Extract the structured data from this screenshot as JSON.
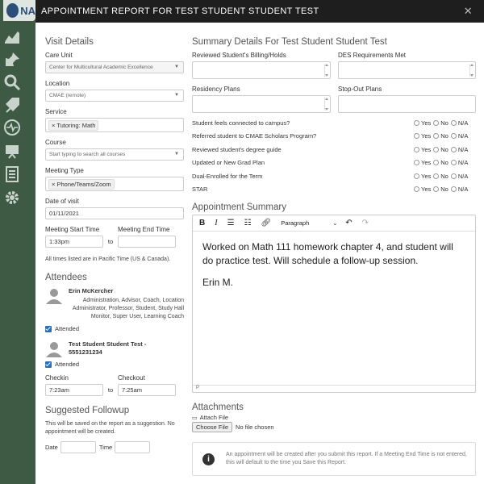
{
  "app": {
    "logo_text": "NA"
  },
  "modal": {
    "title": "APPOINTMENT REPORT FOR TEST STUDENT STUDENT TEST",
    "close": "✕"
  },
  "visit": {
    "title": "Visit Details",
    "care_unit": {
      "label": "Care Unit",
      "value": "Center for Multicultural Academic Excellence"
    },
    "location": {
      "label": "Location",
      "value": "CMAE (remote)"
    },
    "service": {
      "label": "Service",
      "tag": "Tutoring: Math"
    },
    "course": {
      "label": "Course",
      "placeholder": "Start typing to search all courses"
    },
    "meeting_type": {
      "label": "Meeting Type",
      "tag": "Phone/Teams/Zoom"
    },
    "date": {
      "label": "Date of visit",
      "value": "01/11/2021"
    },
    "start": {
      "label": "Meeting Start Time",
      "value": "1:33pm"
    },
    "end": {
      "label": "Meeting End Time",
      "value": ""
    },
    "to": "to",
    "tz_note": "All times listed are in Pacific Time (US & Canada)."
  },
  "attendees": {
    "title": "Attendees",
    "people": [
      {
        "name": "Erin McKercher",
        "roles": "Administration, Advisor, Coach, Location Administrator, Professor, Student, Study Hall Monitor, Super User, Learning Coach",
        "attended": "Attended"
      },
      {
        "name": "Test Student Student Test - 5551231234",
        "attended": "Attended"
      }
    ],
    "checkin": {
      "label": "Checkin",
      "value": "7:23am"
    },
    "checkout": {
      "label": "Checkout",
      "value": "7:25am"
    },
    "to": "to"
  },
  "followup": {
    "title": "Suggested Followup",
    "note": "This will be saved on the report as a suggestion. No appointment will be created.",
    "date_label": "Date",
    "time_label": "Time"
  },
  "summary": {
    "title": "Summary Details For Test Student Student Test",
    "fields": [
      "Reviewed Student's Billing/Holds",
      "DES Requirements Met",
      "Residency Plans",
      "Stop-Out Plans"
    ],
    "questions": [
      "Student feels connected to campus?",
      "Referred student to CMAE Scholars Program?",
      "Reviewed student's degree guide",
      "Updated or New Grad Plan",
      "Dual-Enrolled for the Term",
      "STAR"
    ],
    "options": [
      "Yes",
      "No",
      "N/A"
    ]
  },
  "appointment_summary": {
    "title": "Appointment Summary",
    "toolbar": {
      "bold": "B",
      "italic": "I",
      "paragraph": "Paragraph"
    },
    "text1": "Worked on Math 111 homework chapter 4, and student will do practice test. Will schedule a follow-up session.",
    "text2": "Erin M.",
    "status": "P"
  },
  "attachments": {
    "title": "Attachments",
    "attach_label": "Attach File",
    "choose_button": "Choose File",
    "no_file": "No file chosen"
  },
  "info": {
    "text": "An appointment will be created after you submit this report. If a Meeting End Time is not entered, this will default to the time you Save this Report."
  }
}
